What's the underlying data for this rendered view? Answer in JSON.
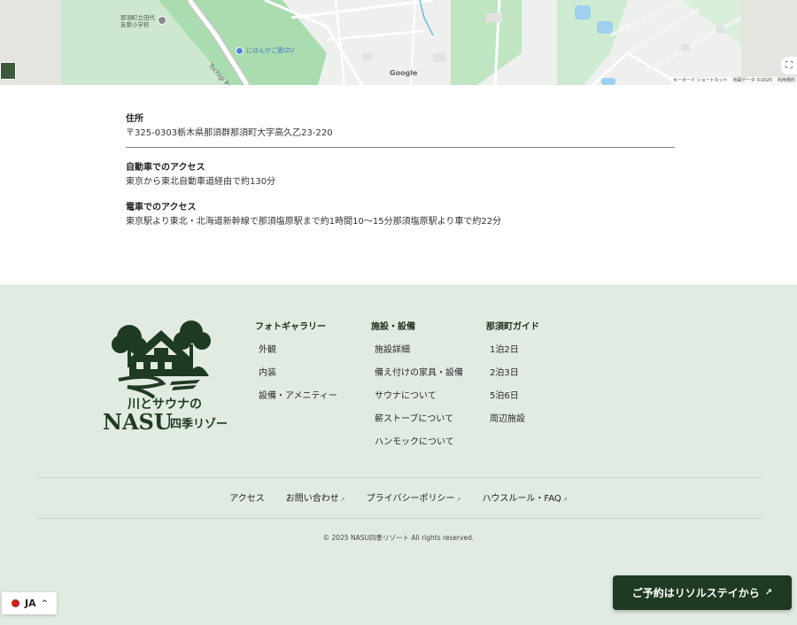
{
  "map": {
    "school_label_1": "那須町立田代",
    "school_label_2": "友愛小学校",
    "poi_label": "にほんかご霊IZU",
    "road_label": "Tochigi Prefe...",
    "google_logo": "Google",
    "footer_shortcuts": "キーボード ショートカット",
    "footer_mapdata": "地図データ ©2025",
    "footer_terms": "利用規約"
  },
  "access": {
    "address_title": "住所",
    "address_text": "〒325-0303栃木県那須群那須町大字高久乙23-220",
    "car_title": "自動車でのアクセス",
    "car_text": "東京から東北自動車道経由で約130分",
    "train_title": "電車でのアクセス",
    "train_text": "東京駅より東北・北海道新幹線で那須塩原駅まで約1時間10〜15分那須塩原駅より車で約22分"
  },
  "footer": {
    "logo_line1": "川とサウナの",
    "logo_line2": "NASU",
    "logo_line3": "四季リゾート",
    "columns": [
      {
        "title": "フォトギャラリー",
        "items": [
          "外観",
          "内装",
          "設備・アメニティー"
        ]
      },
      {
        "title": "施設・設備",
        "items": [
          "施設詳細",
          "備え付けの家具・設備",
          "サウナについて",
          "薪ストーブについて",
          "ハンモックについて"
        ]
      },
      {
        "title": "那須町ガイド",
        "items": [
          "1泊2日",
          "2泊3日",
          "5泊6日",
          "周辺施設"
        ]
      }
    ],
    "bottom_links": {
      "access": "アクセス",
      "contact": "お問い合わせ",
      "privacy": "プライバシーポリシー",
      "rules": "ハウスルール・FAQ"
    },
    "copyright": "© 2025 NASU四季リゾート All rights reserved."
  },
  "lang": {
    "code": "JA"
  },
  "book_button": {
    "label": "ご予約はリソルステイから"
  },
  "colors": {
    "footer_bg": "#e2ebe2",
    "brand_green": "#1f3a22",
    "flag_red": "#cc1f1f"
  }
}
